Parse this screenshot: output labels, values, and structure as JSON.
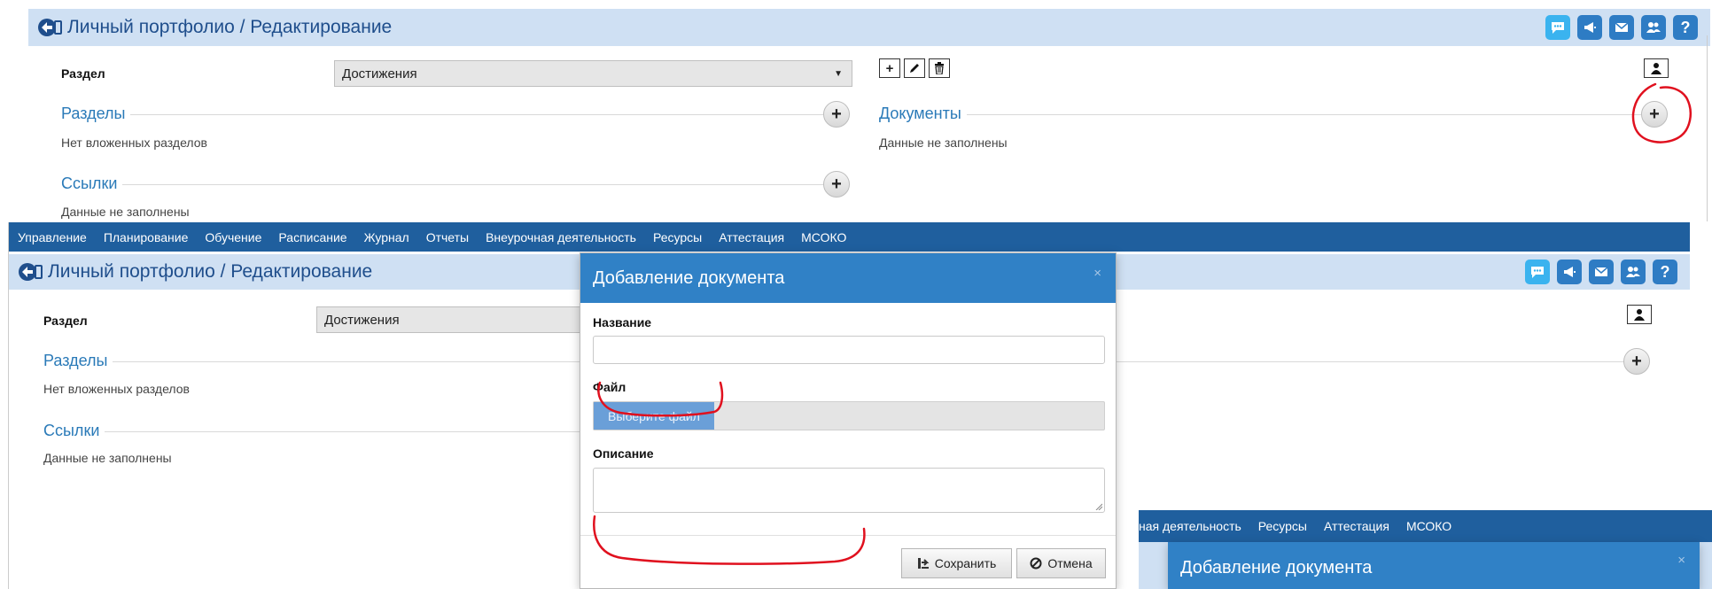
{
  "page": {
    "title": "Личный портфолио / Редактирование"
  },
  "form": {
    "section_label": "Раздел",
    "section_value": "Достижения"
  },
  "sections": {
    "razdely": {
      "title": "Разделы",
      "empty": "Нет вложенных разделов"
    },
    "ssylki": {
      "title": "Ссылки",
      "empty": "Данные не заполнены"
    },
    "dokumenty": {
      "title": "Документы",
      "empty": "Данные не заполнены"
    }
  },
  "nav": {
    "items": [
      "Управление",
      "Планирование",
      "Обучение",
      "Расписание",
      "Журнал",
      "Отчеты",
      "Внеурочная деятельность",
      "Ресурсы",
      "Аттестация",
      "МСОКО"
    ],
    "partial_items": [
      "ная деятельность",
      "Ресурсы",
      "Аттестация",
      "МСОКО"
    ]
  },
  "modal": {
    "title": "Добавление документа",
    "close": "×",
    "name_label": "Название",
    "name_value": "",
    "file_label": "Файл",
    "file_button": "Выберите файл",
    "description_label": "Описание",
    "description_value": "",
    "save": "Сохранить",
    "cancel": "Отмена"
  },
  "icons": {
    "header": [
      "chat-icon",
      "megaphone-icon",
      "mail-icon",
      "users-icon",
      "help-icon"
    ],
    "toolbar": [
      "plus-icon",
      "pencil-icon",
      "trash-icon"
    ]
  },
  "colors": {
    "header_bg": "#cfe0f3",
    "nav_bg": "#1f5f9e",
    "modal_header_bg": "#3081c6",
    "icon_bg": "#2e7cc4",
    "section_title": "#2a7ab8",
    "annotation": "#e0101e"
  }
}
